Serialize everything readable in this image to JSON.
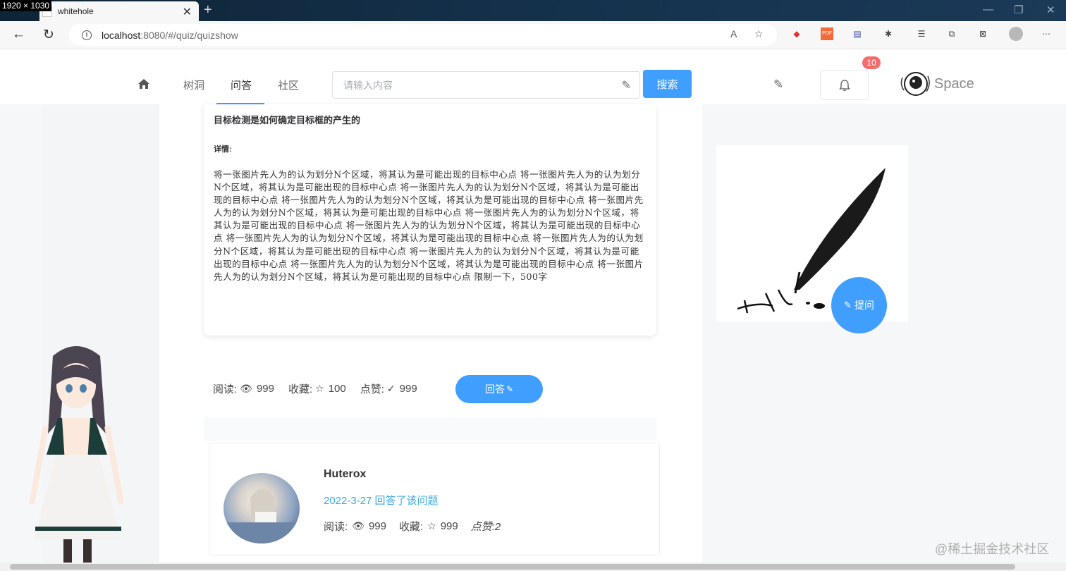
{
  "screen_size_badge": "1920 × 1030",
  "browser": {
    "tab_title": "whitehole",
    "url_host": "localhost",
    "url_path": ":8080/#/quiz/quizshow"
  },
  "nav": {
    "items": [
      "树洞",
      "问答",
      "社区"
    ],
    "search_placeholder": "请输入内容",
    "search_button": "搜索",
    "notification_count": "10",
    "brand": "Space"
  },
  "question": {
    "title": "目标检测是如何确定目标框的产生的",
    "details_label": "详情:",
    "body": "将一张图片先人为的认为划分N个区域，将其认为是可能出现的目标中心点 将一张图片先人为的认为划分N个区域，将其认为是可能出现的目标中心点 将一张图片先人为的认为划分N个区域，将其认为是可能出现的目标中心点 将一张图片先人为的认为划分N个区域，将其认为是可能出现的目标中心点 将一张图片先人为的认为划分N个区域，将其认为是可能出现的目标中心点 将一张图片先人为的认为划分N个区域，将其认为是可能出现的目标中心点 将一张图片先人为的认为划分N个区域，将其认为是可能出现的目标中心点 将一张图片先人为的认为划分N个区域，将其认为是可能出现的目标中心点 将一张图片先人为的认为划分N个区域，将其认为是可能出现的目标中心点 将一张图片先人为的认为划分N个区域，将其认为是可能出现的目标中心点 将一张图片先人为的认为划分N个区域，将其认为是可能出现的目标中心点 将一张图片先人为的认为划分N个区域，将其认为是可能出现的目标中心点 限制一下，500字",
    "views_label": "阅读:",
    "views": "999",
    "favorites_label": "收藏:",
    "favorites": "100",
    "likes_label": "点赞:",
    "likes": "999",
    "answer_button": "回答"
  },
  "answer": {
    "author": "Huterox",
    "date_line": "2022-3-27 回答了该问题",
    "views_label": "阅读:",
    "views": "999",
    "favorites_label": "收藏:",
    "favorites": "999",
    "likes_text": "点赞:2"
  },
  "ask_button": "提问",
  "watermark": "@稀土掘金技术社区",
  "colors": {
    "primary": "#409eff",
    "badge": "#f56c6c",
    "link": "#40a9e0"
  },
  "icons": [
    "home-icon",
    "eye-icon",
    "star-icon",
    "check-icon",
    "pen-icon",
    "bell-icon",
    "edit-icon"
  ]
}
